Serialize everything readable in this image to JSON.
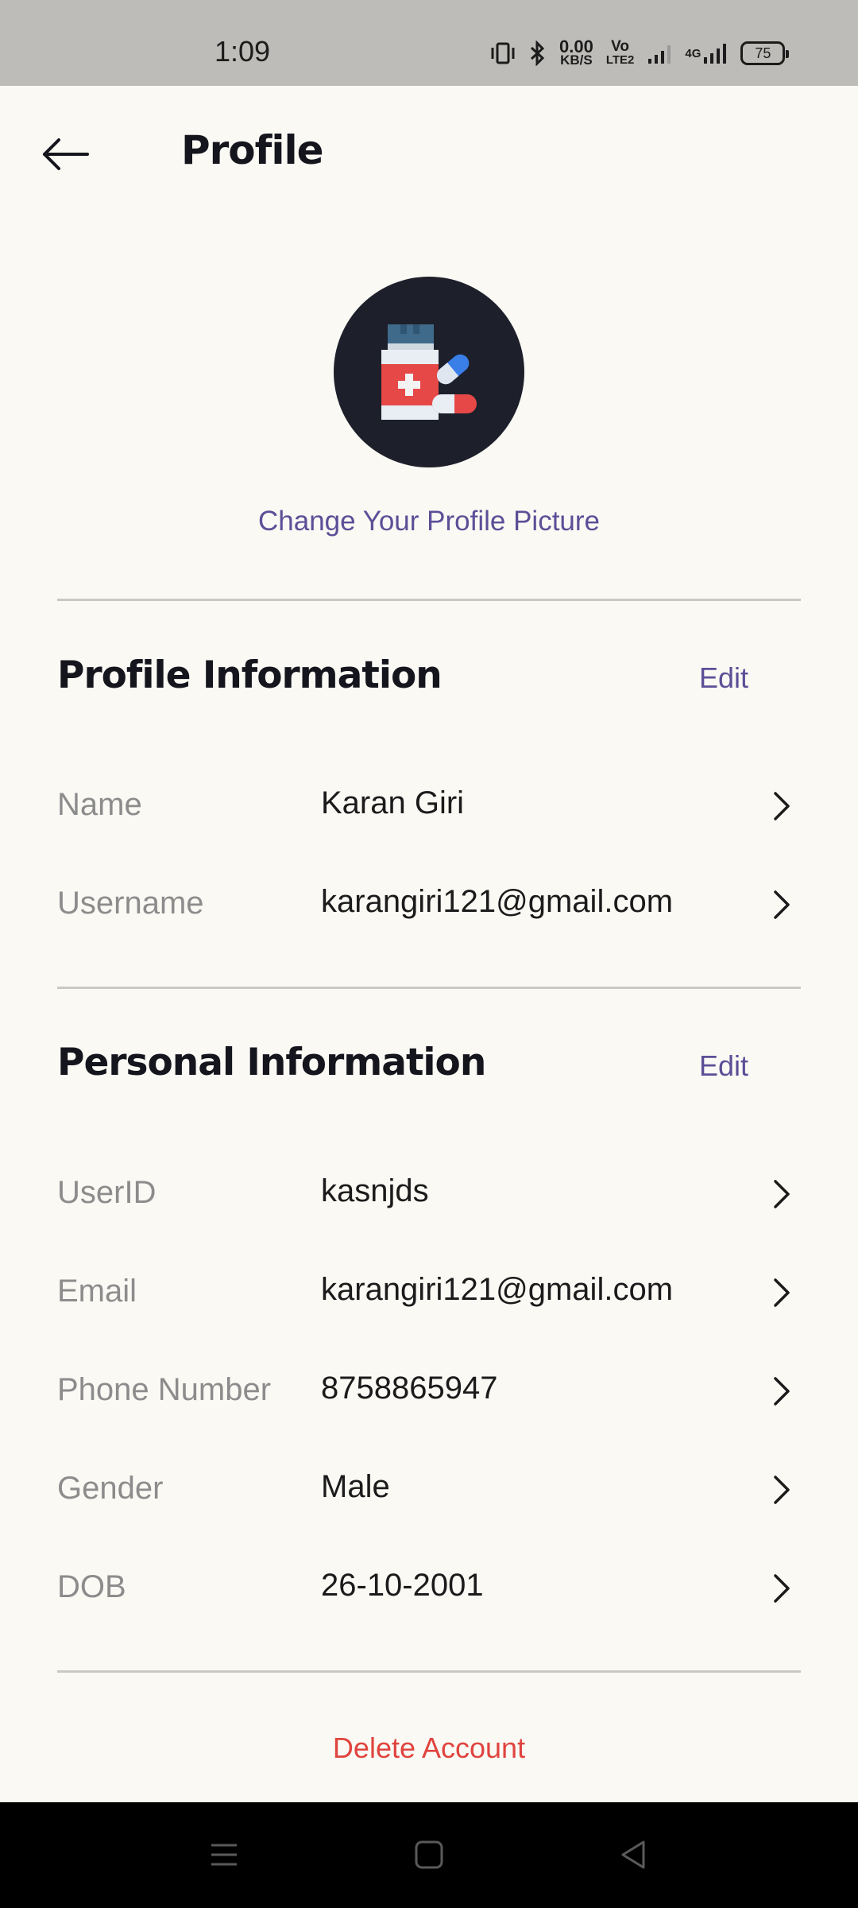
{
  "status_bar": {
    "time": "1:09",
    "net_speed_value": "0.00",
    "net_speed_unit": "KB/S",
    "volte_line1": "Vo",
    "volte_line2": "LTE2",
    "network_type": "4G",
    "battery_level": "75"
  },
  "header": {
    "back_icon": "arrow-left-icon",
    "title": "Profile"
  },
  "avatar": {
    "icon": "medicine-bottle-pills-icon",
    "change_label": "Change Your Profile Picture"
  },
  "profile_section": {
    "title": "Profile Information",
    "edit_label": "Edit",
    "rows": [
      {
        "label": "Name",
        "value": "Karan Giri"
      },
      {
        "label": "Username",
        "value": "karangiri121@gmail.com"
      }
    ]
  },
  "personal_section": {
    "title": "Personal Information",
    "edit_label": "Edit",
    "rows": [
      {
        "label": "UserID",
        "value": "kasnjds"
      },
      {
        "label": "Email",
        "value": "karangiri121@gmail.com"
      },
      {
        "label": "Phone Number",
        "value": "8758865947"
      },
      {
        "label": "Gender",
        "value": "Male"
      },
      {
        "label": "DOB",
        "value": "26-10-2001"
      }
    ]
  },
  "delete_label": "Delete Account",
  "colors": {
    "accent": "#5c4f97",
    "danger": "#e0443f",
    "background": "#faf9f4",
    "avatar_bg": "#1d202b"
  },
  "nav_bar": {
    "buttons": [
      "menu-icon",
      "home-square-icon",
      "back-triangle-icon"
    ]
  }
}
